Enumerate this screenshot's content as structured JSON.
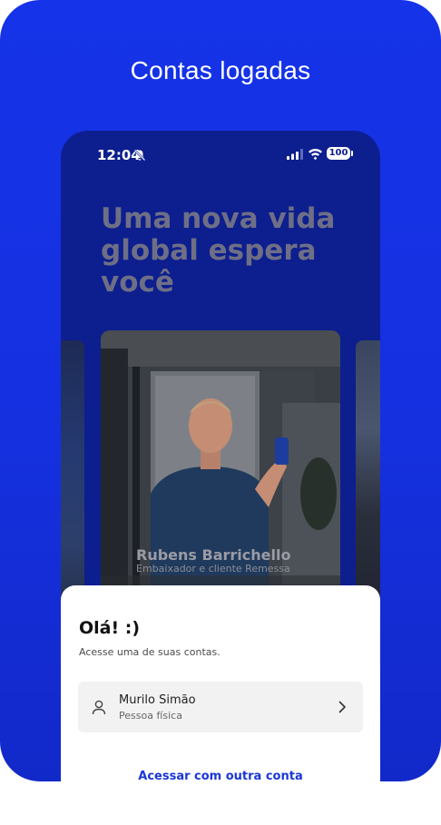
{
  "promo": {
    "title": "Contas logadas"
  },
  "status_bar": {
    "time": "12:04",
    "battery": "100",
    "icons": [
      "bell-slash-icon",
      "signal-icon",
      "wifi-icon",
      "battery-icon"
    ]
  },
  "hero": {
    "headline": "Uma nova vida global espera você",
    "photo": {
      "name": "Rubens Barrichello",
      "caption": "Embaixador e cliente Remessa"
    }
  },
  "sheet": {
    "title": "Olá! :)",
    "subtitle": "Acesse uma de suas contas.",
    "account": {
      "name": "Murilo Simão",
      "type": "Pessoa física",
      "icon": "user-icon"
    },
    "other_account_link": "Acessar com outra conta"
  },
  "colors": {
    "brand_blue": "#1533E8",
    "phone_bg": "#0D1E8F",
    "link_blue": "#1A37D6",
    "headline_gray": "#6E6F86"
  }
}
